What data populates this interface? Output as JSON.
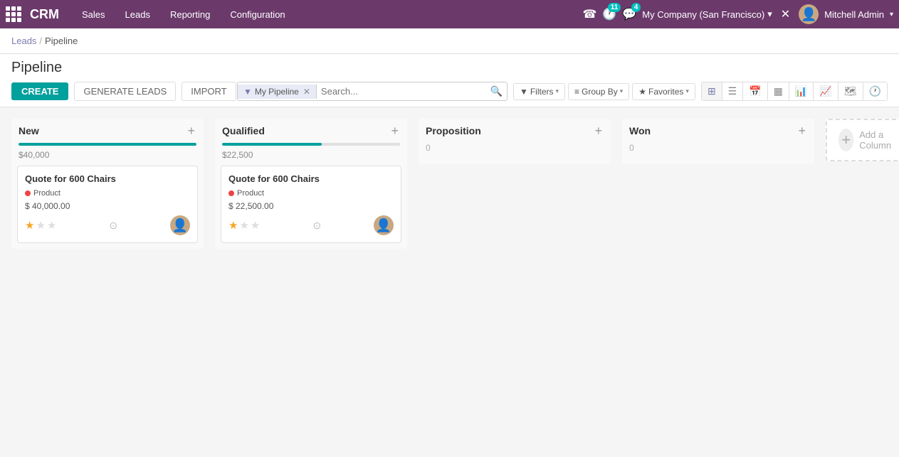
{
  "navbar": {
    "brand": "CRM",
    "menu": [
      {
        "label": "Sales",
        "id": "sales"
      },
      {
        "label": "Leads",
        "id": "leads"
      },
      {
        "label": "Reporting",
        "id": "reporting"
      },
      {
        "label": "Configuration",
        "id": "configuration"
      }
    ],
    "phone_icon": "☎",
    "activity_count": "11",
    "message_count": "4",
    "company": "My Company (San Francisco)",
    "close_icon": "✕",
    "user_name": "Mitchell Admin",
    "user_avatar": "👤"
  },
  "breadcrumb": {
    "parent": "Leads",
    "current": "Pipeline"
  },
  "page": {
    "title": "Pipeline",
    "actions": {
      "create_label": "CREATE",
      "generate_label": "GENERATE LEADS",
      "import_label": "IMPORT"
    },
    "search": {
      "filter_chip_label": "My Pipeline",
      "placeholder": "Search..."
    },
    "controls": {
      "filters_label": "Filters",
      "groupby_label": "Group By",
      "favorites_label": "Favorites"
    }
  },
  "columns": [
    {
      "id": "new",
      "title": "New",
      "amount": "$40,000",
      "progress": 100,
      "cards": [
        {
          "title": "Quote for 600 Chairs",
          "tag": "Product",
          "amount": "$ 40,000.00",
          "stars": 1,
          "total_stars": 3
        }
      ]
    },
    {
      "id": "qualified",
      "title": "Qualified",
      "amount": "$22,500",
      "progress": 56,
      "cards": [
        {
          "title": "Quote for 600 Chairs",
          "tag": "Product",
          "amount": "$ 22,500.00",
          "stars": 1,
          "total_stars": 3
        }
      ]
    },
    {
      "id": "proposition",
      "title": "Proposition",
      "amount": null,
      "count": "0",
      "progress": 0,
      "cards": []
    },
    {
      "id": "won",
      "title": "Won",
      "amount": null,
      "count": "0",
      "progress": 0,
      "cards": []
    }
  ],
  "add_column": {
    "label": "Add a Column",
    "plus": "+"
  }
}
